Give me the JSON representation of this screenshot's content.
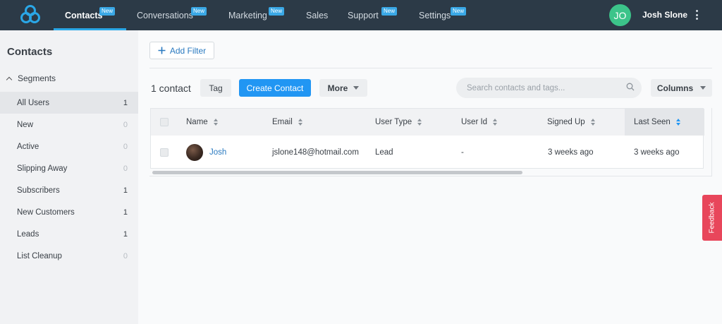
{
  "nav": {
    "items": [
      {
        "label": "Contacts",
        "badge": "New"
      },
      {
        "label": "Conversations",
        "badge": "New"
      },
      {
        "label": "Marketing",
        "badge": "New"
      },
      {
        "label": "Sales",
        "badge": ""
      },
      {
        "label": "Support",
        "badge": "New"
      },
      {
        "label": "Settings",
        "badge": "New"
      }
    ],
    "avatar_initials": "JO",
    "username": "Josh Slone",
    "accent": "#2aa7e7"
  },
  "sidebar": {
    "title": "Contacts",
    "segments_label": "Segments",
    "items": [
      {
        "label": "All Users",
        "count": "1"
      },
      {
        "label": "New",
        "count": "0"
      },
      {
        "label": "Active",
        "count": "0"
      },
      {
        "label": "Slipping Away",
        "count": "0"
      },
      {
        "label": "Subscribers",
        "count": "1"
      },
      {
        "label": "New Customers",
        "count": "1"
      },
      {
        "label": "Leads",
        "count": "1"
      },
      {
        "label": "List Cleanup",
        "count": "0"
      }
    ]
  },
  "toolbar": {
    "add_filter": "Add Filter",
    "contact_count": "1 contact",
    "tag": "Tag",
    "create_contact": "Create Contact",
    "more": "More",
    "search_placeholder": "Search contacts and tags...",
    "columns": "Columns",
    "primary_color": "#2196f3"
  },
  "table": {
    "headers": [
      "Name",
      "Email",
      "User Type",
      "User Id",
      "Signed Up",
      "Last Seen"
    ],
    "rows": [
      {
        "name": "Josh",
        "email": "jslone148@hotmail.com",
        "user_type": "Lead",
        "user_id": "-",
        "signed_up": "3 weeks ago",
        "last_seen": "3 weeks ago"
      }
    ]
  },
  "feedback": {
    "label": "Feedback",
    "color": "#e8465b"
  }
}
